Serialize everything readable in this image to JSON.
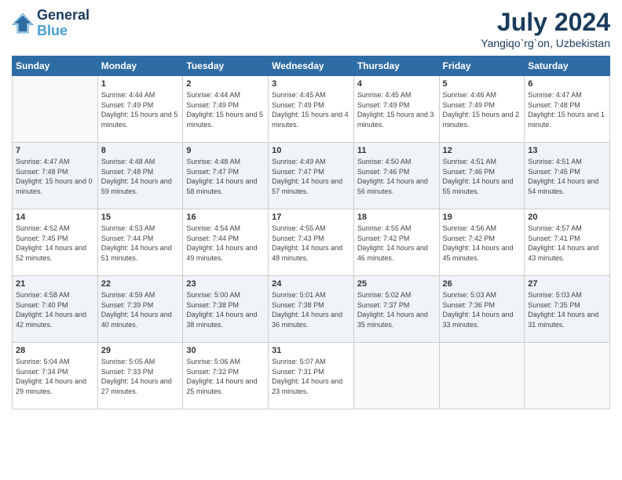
{
  "header": {
    "logo_line1": "General",
    "logo_line2": "Blue",
    "month": "July 2024",
    "location": "Yangiqo`rg`on, Uzbekistan"
  },
  "weekdays": [
    "Sunday",
    "Monday",
    "Tuesday",
    "Wednesday",
    "Thursday",
    "Friday",
    "Saturday"
  ],
  "weeks": [
    [
      {
        "day": "",
        "sunrise": "",
        "sunset": "",
        "daylight": ""
      },
      {
        "day": "1",
        "sunrise": "Sunrise: 4:44 AM",
        "sunset": "Sunset: 7:49 PM",
        "daylight": "Daylight: 15 hours and 5 minutes."
      },
      {
        "day": "2",
        "sunrise": "Sunrise: 4:44 AM",
        "sunset": "Sunset: 7:49 PM",
        "daylight": "Daylight: 15 hours and 5 minutes."
      },
      {
        "day": "3",
        "sunrise": "Sunrise: 4:45 AM",
        "sunset": "Sunset: 7:49 PM",
        "daylight": "Daylight: 15 hours and 4 minutes."
      },
      {
        "day": "4",
        "sunrise": "Sunrise: 4:45 AM",
        "sunset": "Sunset: 7:49 PM",
        "daylight": "Daylight: 15 hours and 3 minutes."
      },
      {
        "day": "5",
        "sunrise": "Sunrise: 4:46 AM",
        "sunset": "Sunset: 7:49 PM",
        "daylight": "Daylight: 15 hours and 2 minutes."
      },
      {
        "day": "6",
        "sunrise": "Sunrise: 4:47 AM",
        "sunset": "Sunset: 7:48 PM",
        "daylight": "Daylight: 15 hours and 1 minute."
      }
    ],
    [
      {
        "day": "7",
        "sunrise": "Sunrise: 4:47 AM",
        "sunset": "Sunset: 7:48 PM",
        "daylight": "Daylight: 15 hours and 0 minutes."
      },
      {
        "day": "8",
        "sunrise": "Sunrise: 4:48 AM",
        "sunset": "Sunset: 7:48 PM",
        "daylight": "Daylight: 14 hours and 59 minutes."
      },
      {
        "day": "9",
        "sunrise": "Sunrise: 4:48 AM",
        "sunset": "Sunset: 7:47 PM",
        "daylight": "Daylight: 14 hours and 58 minutes."
      },
      {
        "day": "10",
        "sunrise": "Sunrise: 4:49 AM",
        "sunset": "Sunset: 7:47 PM",
        "daylight": "Daylight: 14 hours and 57 minutes."
      },
      {
        "day": "11",
        "sunrise": "Sunrise: 4:50 AM",
        "sunset": "Sunset: 7:46 PM",
        "daylight": "Daylight: 14 hours and 56 minutes."
      },
      {
        "day": "12",
        "sunrise": "Sunrise: 4:51 AM",
        "sunset": "Sunset: 7:46 PM",
        "daylight": "Daylight: 14 hours and 55 minutes."
      },
      {
        "day": "13",
        "sunrise": "Sunrise: 4:51 AM",
        "sunset": "Sunset: 7:45 PM",
        "daylight": "Daylight: 14 hours and 54 minutes."
      }
    ],
    [
      {
        "day": "14",
        "sunrise": "Sunrise: 4:52 AM",
        "sunset": "Sunset: 7:45 PM",
        "daylight": "Daylight: 14 hours and 52 minutes."
      },
      {
        "day": "15",
        "sunrise": "Sunrise: 4:53 AM",
        "sunset": "Sunset: 7:44 PM",
        "daylight": "Daylight: 14 hours and 51 minutes."
      },
      {
        "day": "16",
        "sunrise": "Sunrise: 4:54 AM",
        "sunset": "Sunset: 7:44 PM",
        "daylight": "Daylight: 14 hours and 49 minutes."
      },
      {
        "day": "17",
        "sunrise": "Sunrise: 4:55 AM",
        "sunset": "Sunset: 7:43 PM",
        "daylight": "Daylight: 14 hours and 48 minutes."
      },
      {
        "day": "18",
        "sunrise": "Sunrise: 4:55 AM",
        "sunset": "Sunset: 7:42 PM",
        "daylight": "Daylight: 14 hours and 46 minutes."
      },
      {
        "day": "19",
        "sunrise": "Sunrise: 4:56 AM",
        "sunset": "Sunset: 7:42 PM",
        "daylight": "Daylight: 14 hours and 45 minutes."
      },
      {
        "day": "20",
        "sunrise": "Sunrise: 4:57 AM",
        "sunset": "Sunset: 7:41 PM",
        "daylight": "Daylight: 14 hours and 43 minutes."
      }
    ],
    [
      {
        "day": "21",
        "sunrise": "Sunrise: 4:58 AM",
        "sunset": "Sunset: 7:40 PM",
        "daylight": "Daylight: 14 hours and 42 minutes."
      },
      {
        "day": "22",
        "sunrise": "Sunrise: 4:59 AM",
        "sunset": "Sunset: 7:39 PM",
        "daylight": "Daylight: 14 hours and 40 minutes."
      },
      {
        "day": "23",
        "sunrise": "Sunrise: 5:00 AM",
        "sunset": "Sunset: 7:38 PM",
        "daylight": "Daylight: 14 hours and 38 minutes."
      },
      {
        "day": "24",
        "sunrise": "Sunrise: 5:01 AM",
        "sunset": "Sunset: 7:38 PM",
        "daylight": "Daylight: 14 hours and 36 minutes."
      },
      {
        "day": "25",
        "sunrise": "Sunrise: 5:02 AM",
        "sunset": "Sunset: 7:37 PM",
        "daylight": "Daylight: 14 hours and 35 minutes."
      },
      {
        "day": "26",
        "sunrise": "Sunrise: 5:03 AM",
        "sunset": "Sunset: 7:36 PM",
        "daylight": "Daylight: 14 hours and 33 minutes."
      },
      {
        "day": "27",
        "sunrise": "Sunrise: 5:03 AM",
        "sunset": "Sunset: 7:35 PM",
        "daylight": "Daylight: 14 hours and 31 minutes."
      }
    ],
    [
      {
        "day": "28",
        "sunrise": "Sunrise: 5:04 AM",
        "sunset": "Sunset: 7:34 PM",
        "daylight": "Daylight: 14 hours and 29 minutes."
      },
      {
        "day": "29",
        "sunrise": "Sunrise: 5:05 AM",
        "sunset": "Sunset: 7:33 PM",
        "daylight": "Daylight: 14 hours and 27 minutes."
      },
      {
        "day": "30",
        "sunrise": "Sunrise: 5:06 AM",
        "sunset": "Sunset: 7:32 PM",
        "daylight": "Daylight: 14 hours and 25 minutes."
      },
      {
        "day": "31",
        "sunrise": "Sunrise: 5:07 AM",
        "sunset": "Sunset: 7:31 PM",
        "daylight": "Daylight: 14 hours and 23 minutes."
      },
      {
        "day": "",
        "sunrise": "",
        "sunset": "",
        "daylight": ""
      },
      {
        "day": "",
        "sunrise": "",
        "sunset": "",
        "daylight": ""
      },
      {
        "day": "",
        "sunrise": "",
        "sunset": "",
        "daylight": ""
      }
    ]
  ]
}
